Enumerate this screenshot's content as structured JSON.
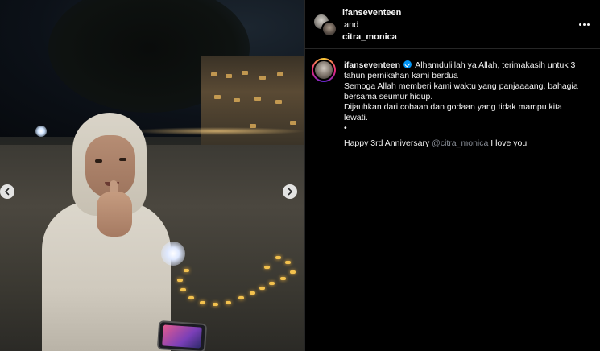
{
  "post": {
    "collaborator_1": "ifanseventeen",
    "and_text": "and",
    "collaborator_2": "citra_monica",
    "more_label": "More options"
  },
  "caption": {
    "username": "ifanseventeen",
    "line1": "Alhamdulillah ya Allah, terimakasih untuk 3 tahun pernikahan kami berdua",
    "line2": "Semoga Allah memberi kami waktu yang panjaaaang, bahagia bersama seumur hidup.",
    "line3": "Dijauhkan dari cobaan dan godaan yang tidak mampu kita lewati.",
    "bullet": "•",
    "line4_prefix": "Happy 3rd Anniversary",
    "mention": "@citra_monica",
    "line4_suffix": "I love you"
  },
  "media": {
    "prev_icon": "chevron-left-icon",
    "next_icon": "chevron-right-icon"
  },
  "colors": {
    "background": "#000000",
    "verified": "#0095f6",
    "mention": "#8a8f98",
    "divider": "#262626"
  }
}
